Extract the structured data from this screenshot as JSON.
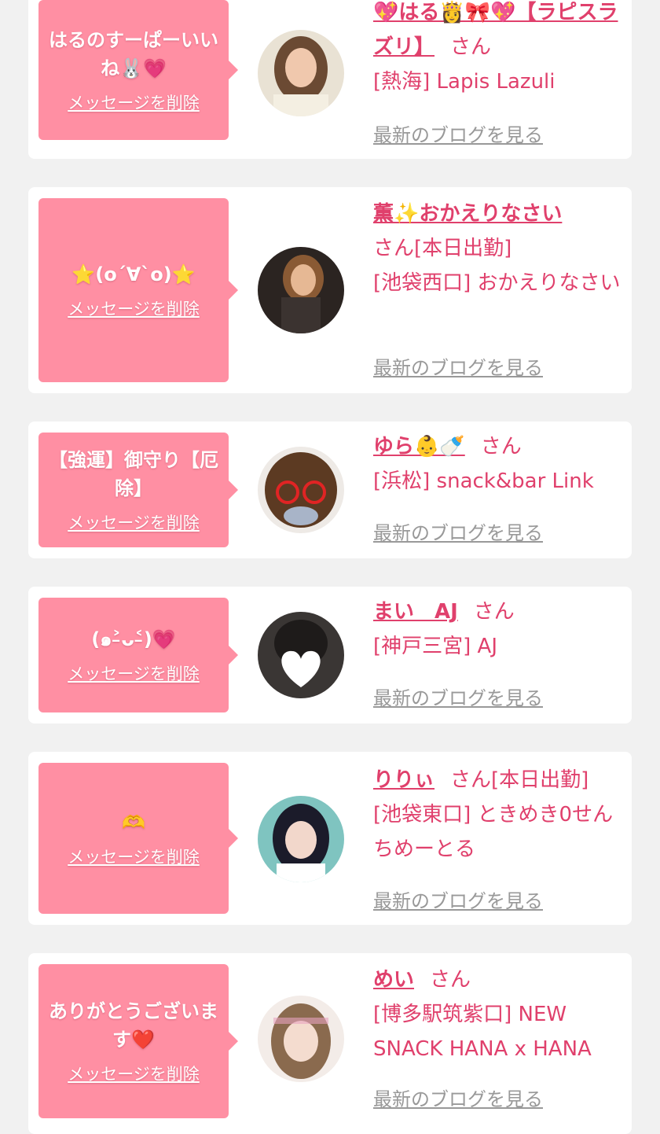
{
  "items": [
    {
      "message": "はるのすーぱーいいね🐰💗",
      "delete_label": "メッセージを削除",
      "name": "💖はる👸🎀💖【ラピスラズリ】",
      "honorific": "さん",
      "status": "",
      "location": "[熱海] Lapis Lazuli",
      "blog_label": "最新のブログを見る"
    },
    {
      "message": "⭐(o´∀`o)⭐",
      "delete_label": "メッセージを削除",
      "name": "薫✨おかえりなさい",
      "honorific": "さん",
      "status": "[本日出勤]",
      "location": "[池袋西口] おかえりなさい",
      "blog_label": "最新のブログを見る"
    },
    {
      "message": "【強運】御守り【厄除】",
      "delete_label": "メッセージを削除",
      "name": "ゆら👶🍼",
      "honorific": "さん",
      "status": "",
      "location": "[浜松] snack&bar Link",
      "blog_label": "最新のブログを見る"
    },
    {
      "message": "(๑˃̵ᴗ˂̵)💗",
      "delete_label": "メッセージを削除",
      "name": "まい　AJ",
      "honorific": "さん",
      "status": "",
      "location": "[神戸三宮] AJ",
      "blog_label": "最新のブログを見る"
    },
    {
      "message": "🫶",
      "delete_label": "メッセージを削除",
      "name": "りりぃ",
      "honorific": "さん",
      "status": "[本日出勤]",
      "location": "[池袋東口] ときめき0せんちめーとる",
      "blog_label": "最新のブログを見る"
    },
    {
      "message": "ありがとうございます❤️",
      "delete_label": "メッセージを削除",
      "name": "めい",
      "honorific": "さん",
      "status": "",
      "location": "[博多駅筑紫口] NEW SNACK HANA x HANA",
      "blog_label": "最新のブログを見る"
    }
  ],
  "colors": {
    "page_bg": "#f1f1f1",
    "card_bg": "#ffffff",
    "bubble_bg": "#ff8fa3",
    "accent_text": "#e0406c",
    "muted_link": "#999999"
  }
}
